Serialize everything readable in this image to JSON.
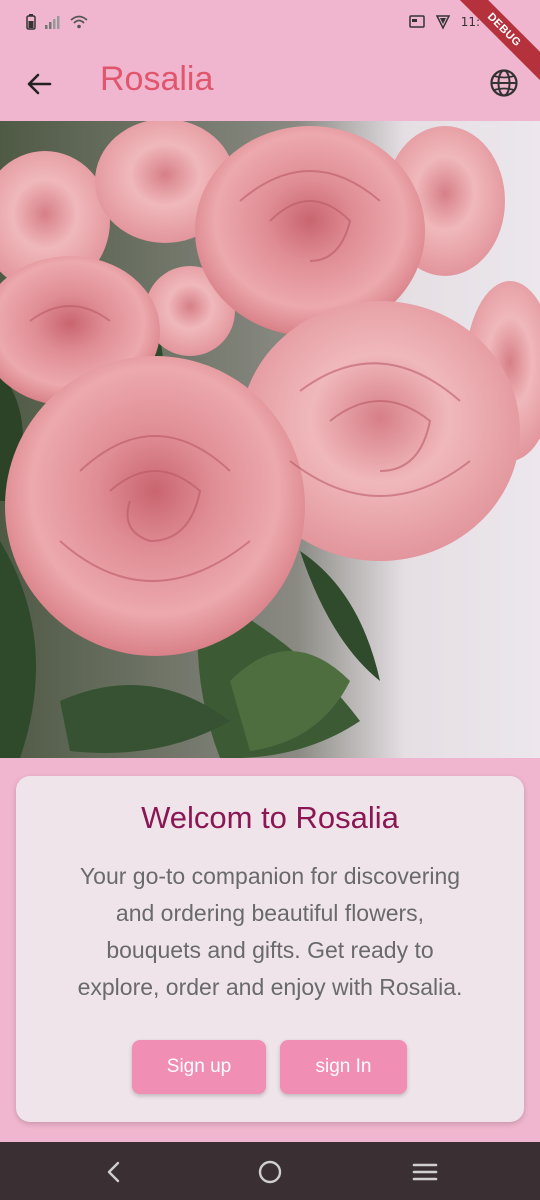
{
  "status_bar": {
    "time_partial": "11:",
    "debug_label": "DEBUG"
  },
  "app_bar": {
    "title": "Rosalia"
  },
  "hero": {
    "image": "pink-roses-bouquet"
  },
  "welcome_card": {
    "title": "Welcom to Rosalia",
    "lines": [
      "Your go-to companion for discovering",
      "and ordering beautiful flowers,",
      "bouquets and gifts. Get ready to",
      "explore, order and enjoy with Rosalia."
    ],
    "signup_label": "Sign up",
    "signin_label": "sign In"
  },
  "icons": [
    "back-arrow-icon",
    "globe-icon",
    "nav-back-icon",
    "nav-home-icon",
    "nav-menu-icon"
  ],
  "colors": {
    "background": "#f1b6cf",
    "title": "#e0566d",
    "card_title": "#8b1654",
    "button": "#f08eb4",
    "nav_bar": "#3a3034"
  }
}
